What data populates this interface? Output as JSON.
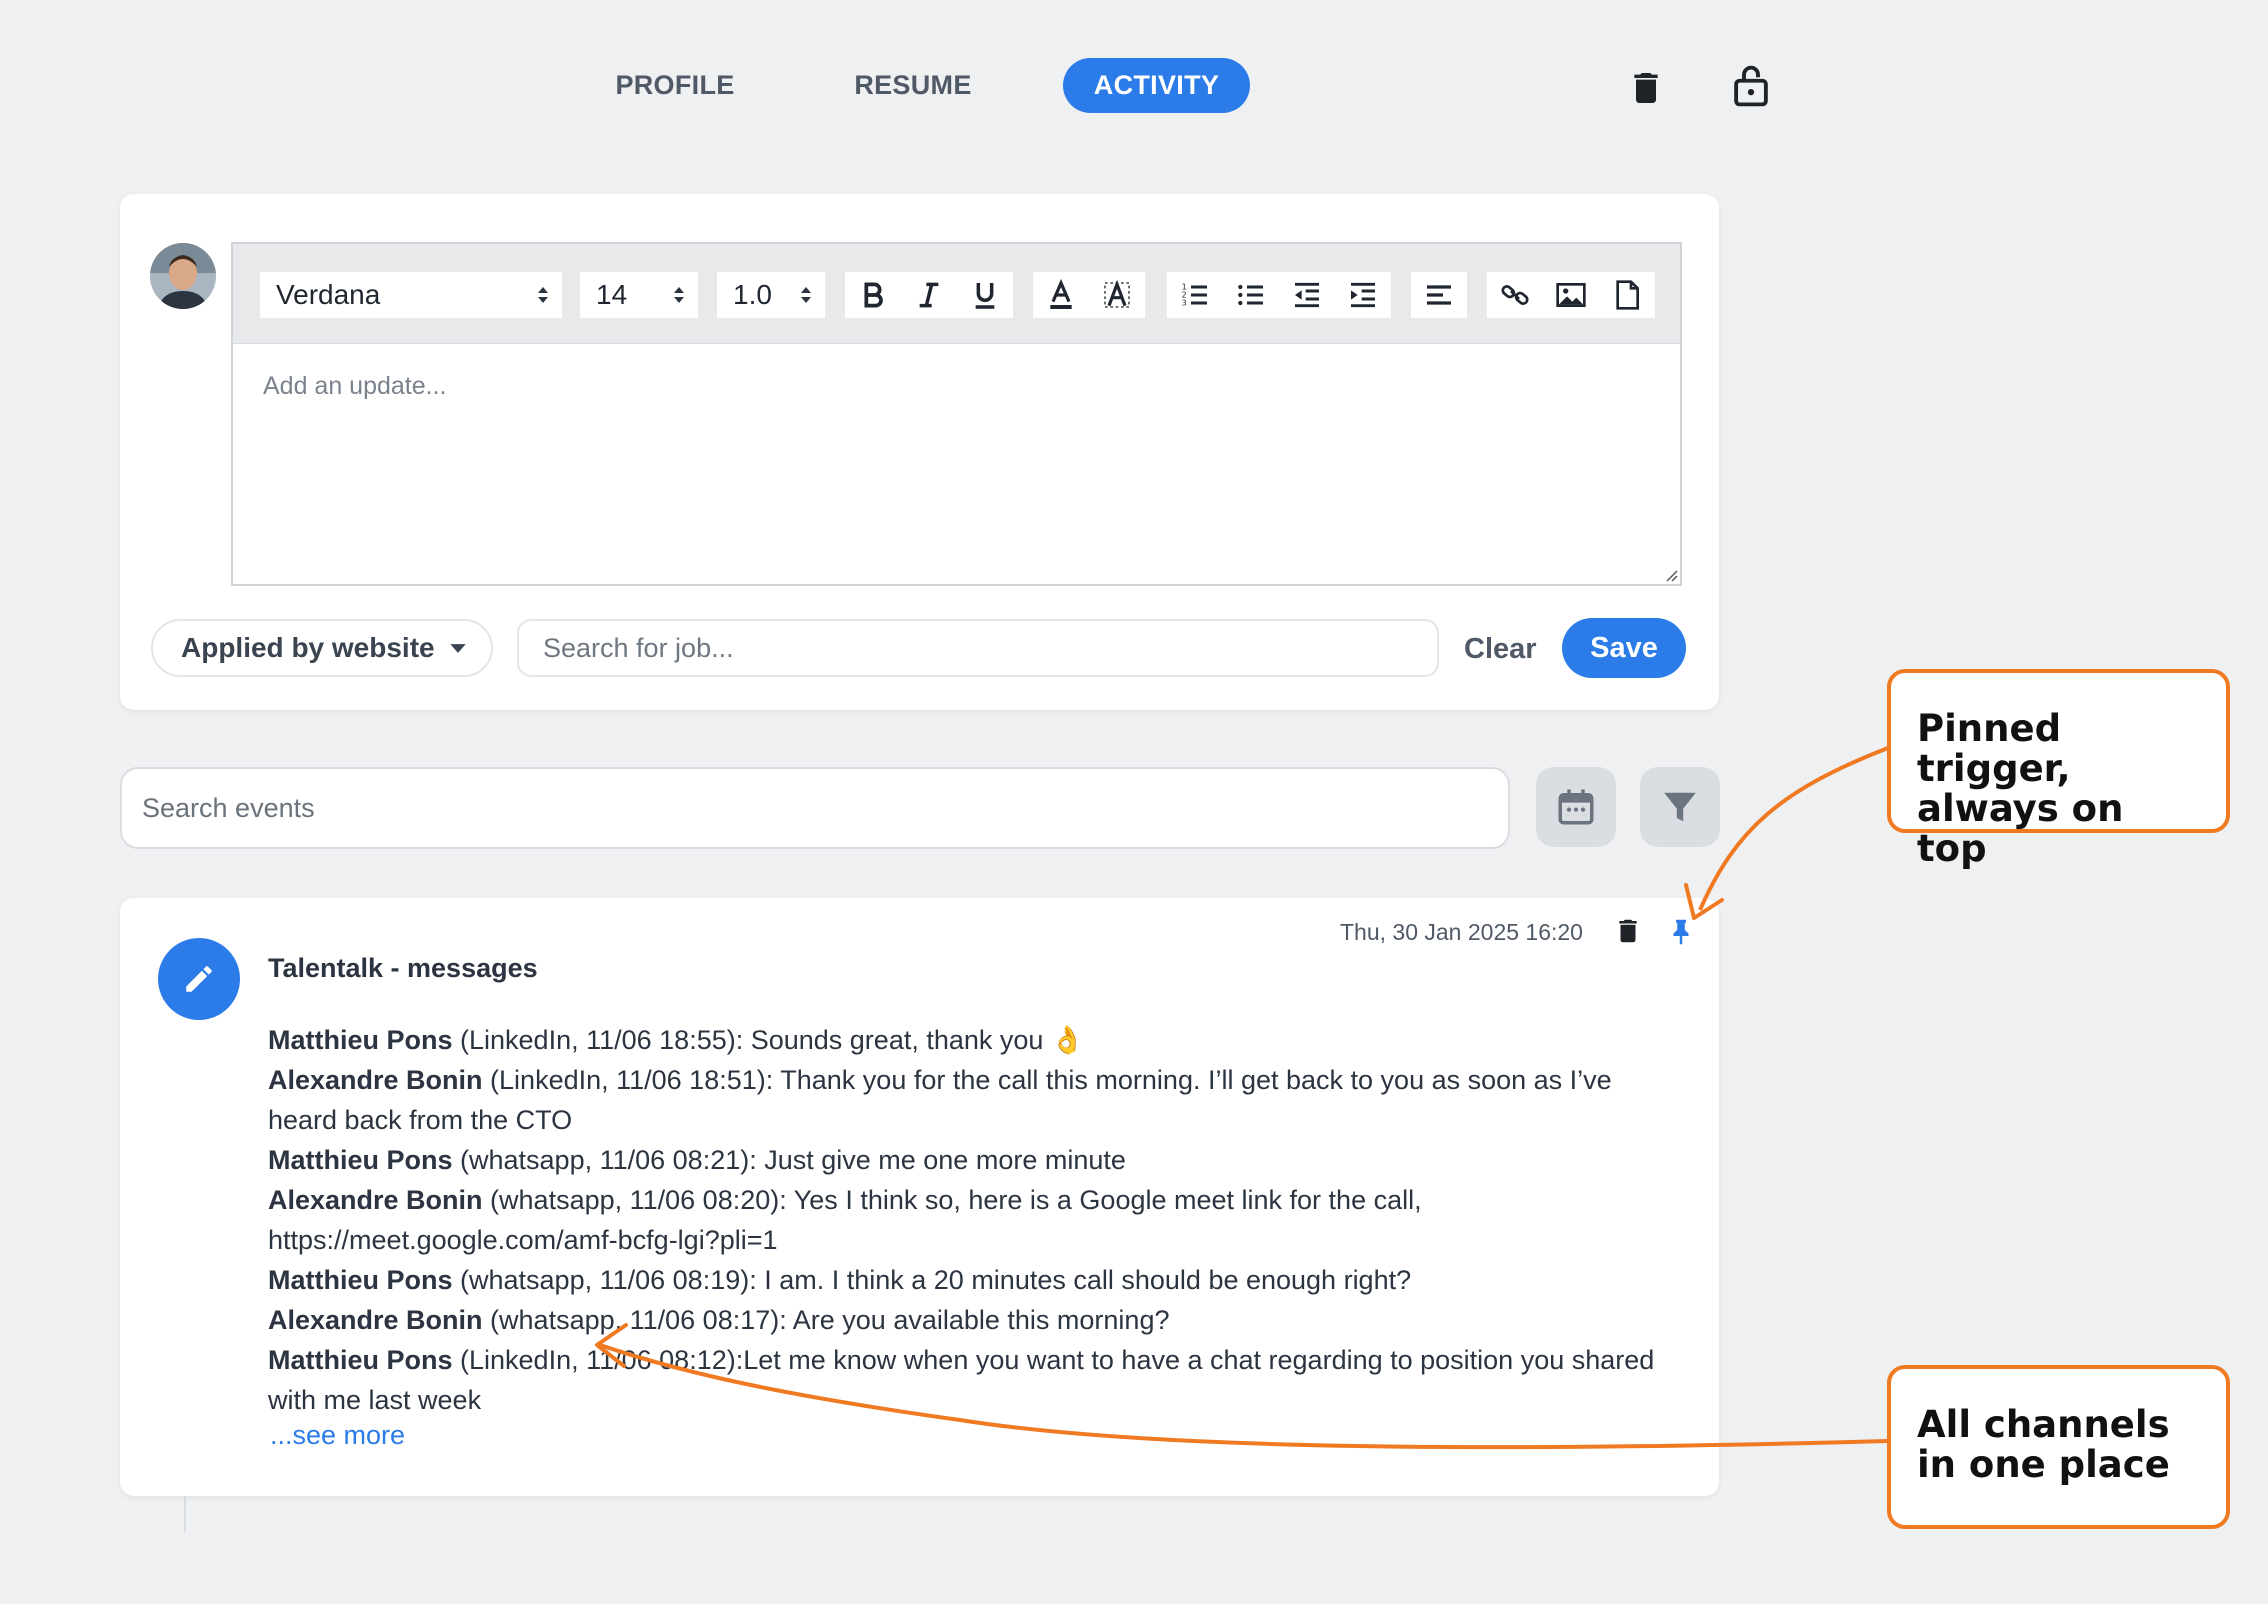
{
  "tabs": [
    {
      "label": "PROFILE",
      "active": false
    },
    {
      "label": "RESUME",
      "active": false
    },
    {
      "label": "ACTIVITY",
      "active": true
    }
  ],
  "top_actions": {
    "delete_icon": "trash-icon",
    "lock_icon": "unlock-icon"
  },
  "editor": {
    "font_family": "Verdana",
    "font_size": "14",
    "line_height": "1.0",
    "placeholder": "Add an update...",
    "toolbar_icons": [
      "bold-icon",
      "italic-icon",
      "underline-icon",
      "text-color-icon",
      "highlight-icon",
      "ordered-list-icon",
      "bullet-list-icon",
      "outdent-icon",
      "indent-icon",
      "align-icon",
      "link-icon",
      "image-icon",
      "file-icon"
    ]
  },
  "composer": {
    "source_label": "Applied by website",
    "job_search_placeholder": "Search for job...",
    "clear_label": "Clear",
    "save_label": "Save"
  },
  "events_search": {
    "placeholder": "Search events"
  },
  "event": {
    "title": "Talentalk - messages",
    "date": "Thu, 30 Jan 2025 16:20",
    "messages": [
      {
        "author": "Matthieu Pons",
        "meta": " (LinkedIn, 11/06 18:55): ",
        "text": "Sounds great, thank you 👌"
      },
      {
        "author": "Alexandre Bonin",
        "meta": " (LinkedIn, 11/06 18:51): ",
        "text": "Thank you for the call this morning. I’ll get back to you as soon as I’ve heard back from the CTO"
      },
      {
        "author": "Matthieu Pons",
        "meta": " (whatsapp, 11/06 08:21): ",
        "text": "Just give me one more minute"
      },
      {
        "author": "Alexandre Bonin",
        "meta": " (whatsapp, 11/06 08:20): ",
        "text": "Yes I think so, here is a Google meet link for the call, https://meet.google.com/amf-bcfg-lgi?pli=1"
      },
      {
        "author": "Matthieu Pons",
        "meta": " (whatsapp, 11/06 08:19): ",
        "text": "I am. I think a 20 minutes call should be enough right?"
      },
      {
        "author": "Alexandre Bonin",
        "meta": " (whatsapp, 11/06 08:17): ",
        "text": "Are you available this morning?"
      },
      {
        "author": "Matthieu Pons",
        "meta": " (LinkedIn, 11/06 08:12):",
        "text": "Let me know when you want to have a chat regarding to position you shared with me last week"
      }
    ],
    "see_more": "...see more"
  },
  "callouts": {
    "pinned": "Pinned trigger, always on top",
    "channels": "All channels in one place"
  },
  "colors": {
    "accent": "#2b7be9",
    "callout": "#f07a22",
    "background": "#eff0f2"
  }
}
